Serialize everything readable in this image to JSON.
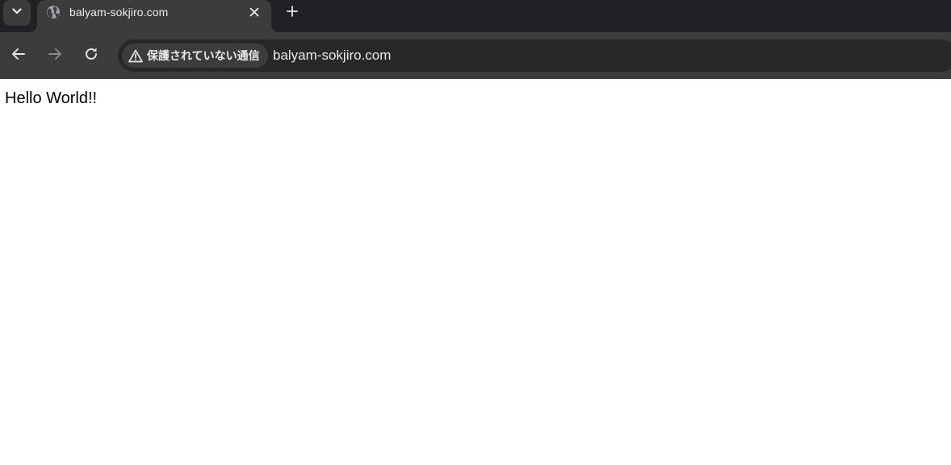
{
  "browser": {
    "tab": {
      "title": "balyam-sokjiro.com",
      "favicon": "globe-icon"
    },
    "toolbar": {
      "security_label": "保護されていない通信",
      "url": "balyam-sokjiro.com"
    },
    "icons": {
      "tab_search": "chevron-down-icon",
      "tab_close": "close-icon",
      "new_tab": "plus-icon",
      "back": "arrow-left-icon",
      "forward": "arrow-right-icon",
      "reload": "reload-icon",
      "security": "warning-icon"
    },
    "colors": {
      "frame": "#202124",
      "toolbar": "#3c3c3c",
      "omnibox": "#282828",
      "text": "#e8eaed",
      "disabled": "#8a8a8a"
    }
  },
  "page": {
    "body_text": "Hello World!!"
  }
}
